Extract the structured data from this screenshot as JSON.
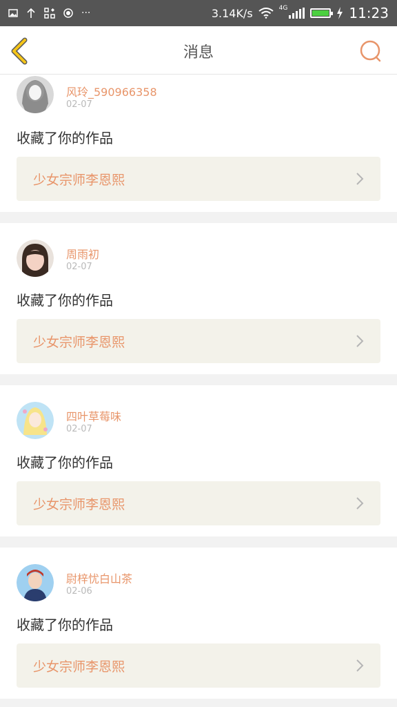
{
  "status_bar": {
    "net_speed": "3.14K/s",
    "network_type": "4G",
    "time": "11:23",
    "battery_level": 1.0,
    "battery_color": "#4cd040",
    "icons": [
      "image-icon",
      "upload-icon",
      "apps-icon",
      "record-icon",
      "more-icon",
      "wifi-icon",
      "signal-icon",
      "charging-icon"
    ]
  },
  "nav": {
    "title": "消息",
    "accent": "#e8956a",
    "back_color": "#f5c518"
  },
  "messages": [
    {
      "username": "风玲_590966358",
      "date": "02-07",
      "action": "收藏了你的作品",
      "work_title": "少女宗师李恩熙",
      "avatar_colors": [
        "#d8d8d8",
        "#5a5a5a"
      ]
    },
    {
      "username": "周雨初",
      "date": "02-07",
      "action": "收藏了你的作品",
      "work_title": "少女宗师李恩熙",
      "avatar_colors": [
        "#f4d2c4",
        "#3a2a22"
      ]
    },
    {
      "username": "四叶草莓味",
      "date": "02-07",
      "action": "收藏了你的作品",
      "work_title": "少女宗师李恩熙",
      "avatar_colors": [
        "#bfe3f5",
        "#f7e48a"
      ]
    },
    {
      "username": "尉梓忧白山茶",
      "date": "02-06",
      "action": "收藏了你的作品",
      "work_title": "少女宗师李恩熙",
      "avatar_colors": [
        "#9fd0f0",
        "#2a3d6e"
      ]
    }
  ]
}
